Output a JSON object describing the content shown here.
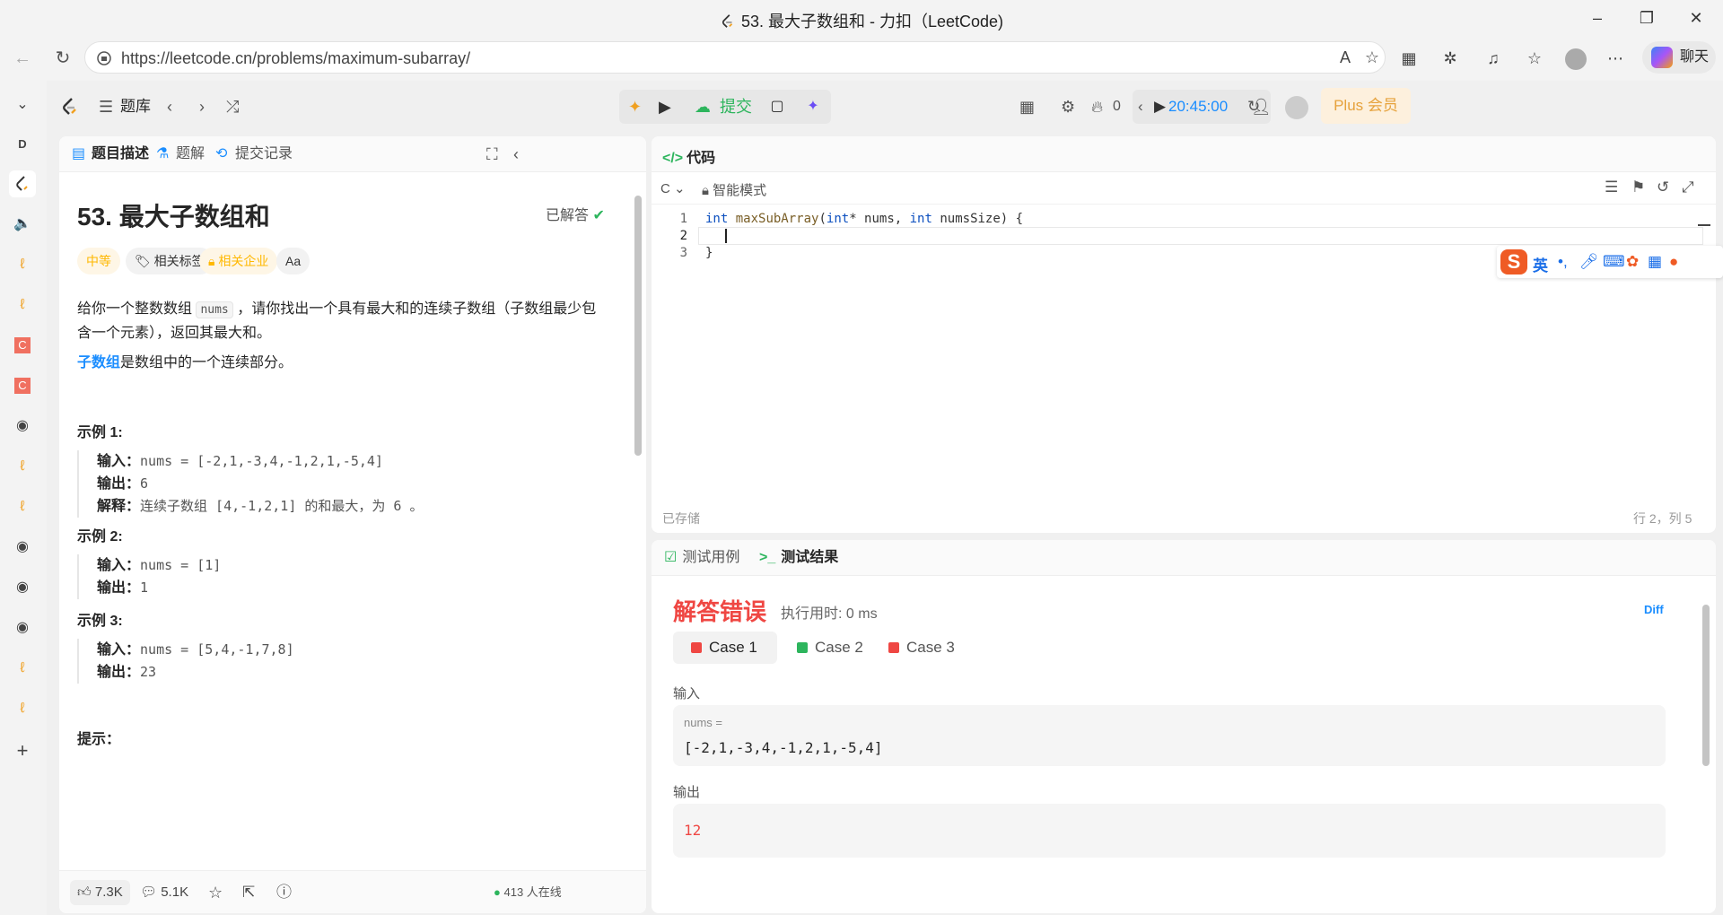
{
  "browser": {
    "window_title": "53. 最大子数组和 - 力扣（LeetCode)",
    "url": "https://leetcode.cn/problems/maximum-subarray/",
    "copilot_label": "聊天"
  },
  "nav": {
    "tiku_label": "题库",
    "submit_label": "提交",
    "streak_count": "0",
    "timer": "20:45:00",
    "plus_label": "Plus 会员"
  },
  "left_tabs": [
    {
      "label": "题目描述"
    },
    {
      "label": "题解"
    },
    {
      "label": "提交记录"
    }
  ],
  "problem": {
    "title": "53. 最大子数组和",
    "solved_label": "已解答",
    "difficulty": "中等",
    "tag_topics": "相关标签",
    "tag_companies": "相关企业",
    "font_tag": "Aa",
    "desc_before_code": "给你一个整数数组 ",
    "desc_code": "nums",
    "desc_after_code": " ，请你找出一个具有最大和的连续子数组（子数组最少包含一个元素），返回其最大和。",
    "subarray_link": "子数组",
    "subarray_def": "是数组中的一个连续部分。",
    "examples": [
      {
        "title": "示例 1:",
        "input_label": "输入：",
        "input": "nums = [-2,1,-3,4,-1,2,1,-5,4]",
        "output_label": "输出：",
        "output": "6",
        "explain_label": "解释：",
        "explain": "连续子数组 [4,-1,2,1] 的和最大，为 6 。"
      },
      {
        "title": "示例 2:",
        "input_label": "输入：",
        "input": "nums = [1]",
        "output_label": "输出：",
        "output": "1"
      },
      {
        "title": "示例 3:",
        "input_label": "输入：",
        "input": "nums = [5,4,-1,7,8]",
        "output_label": "输出：",
        "output": "23"
      }
    ],
    "hints_title": "提示："
  },
  "left_footer": {
    "likes": "7.3K",
    "comments": "5.1K",
    "online": "413 人在线"
  },
  "code": {
    "panel_title": "代码",
    "language": "C",
    "mode_label": "智能模式",
    "lines": [
      "1",
      "2",
      "3"
    ],
    "line1_kw1": "int",
    "line1_fn": "maxSubArray",
    "line1_rest1": "(",
    "line1_kw2": "int",
    "line1_rest2": "* nums, ",
    "line1_kw3": "int",
    "line1_rest3": " numsSize) {",
    "line3": "}",
    "saved_label": "已存储",
    "cursor_pos": "行 2，列 5"
  },
  "ime": {
    "logo": "S",
    "lang": "英"
  },
  "result": {
    "tab_testcase": "测试用例",
    "tab_result": "测试结果",
    "status": "解答错误",
    "runtime": "执行用时: 0 ms",
    "diff_label": "Diff",
    "cases": [
      {
        "label": "Case 1",
        "state": "fail"
      },
      {
        "label": "Case 2",
        "state": "pass"
      },
      {
        "label": "Case 3",
        "state": "fail"
      }
    ],
    "input_label": "输入",
    "input_var": "nums =",
    "input_value": "[-2,1,-3,4,-1,2,1,-5,4]",
    "output_label": "输出",
    "output_value": "12"
  },
  "colors": {
    "accent_green": "#2db55d",
    "error_red": "#ef4743",
    "link_blue": "#1a8dff",
    "difficulty_yellow": "#ffb800"
  }
}
